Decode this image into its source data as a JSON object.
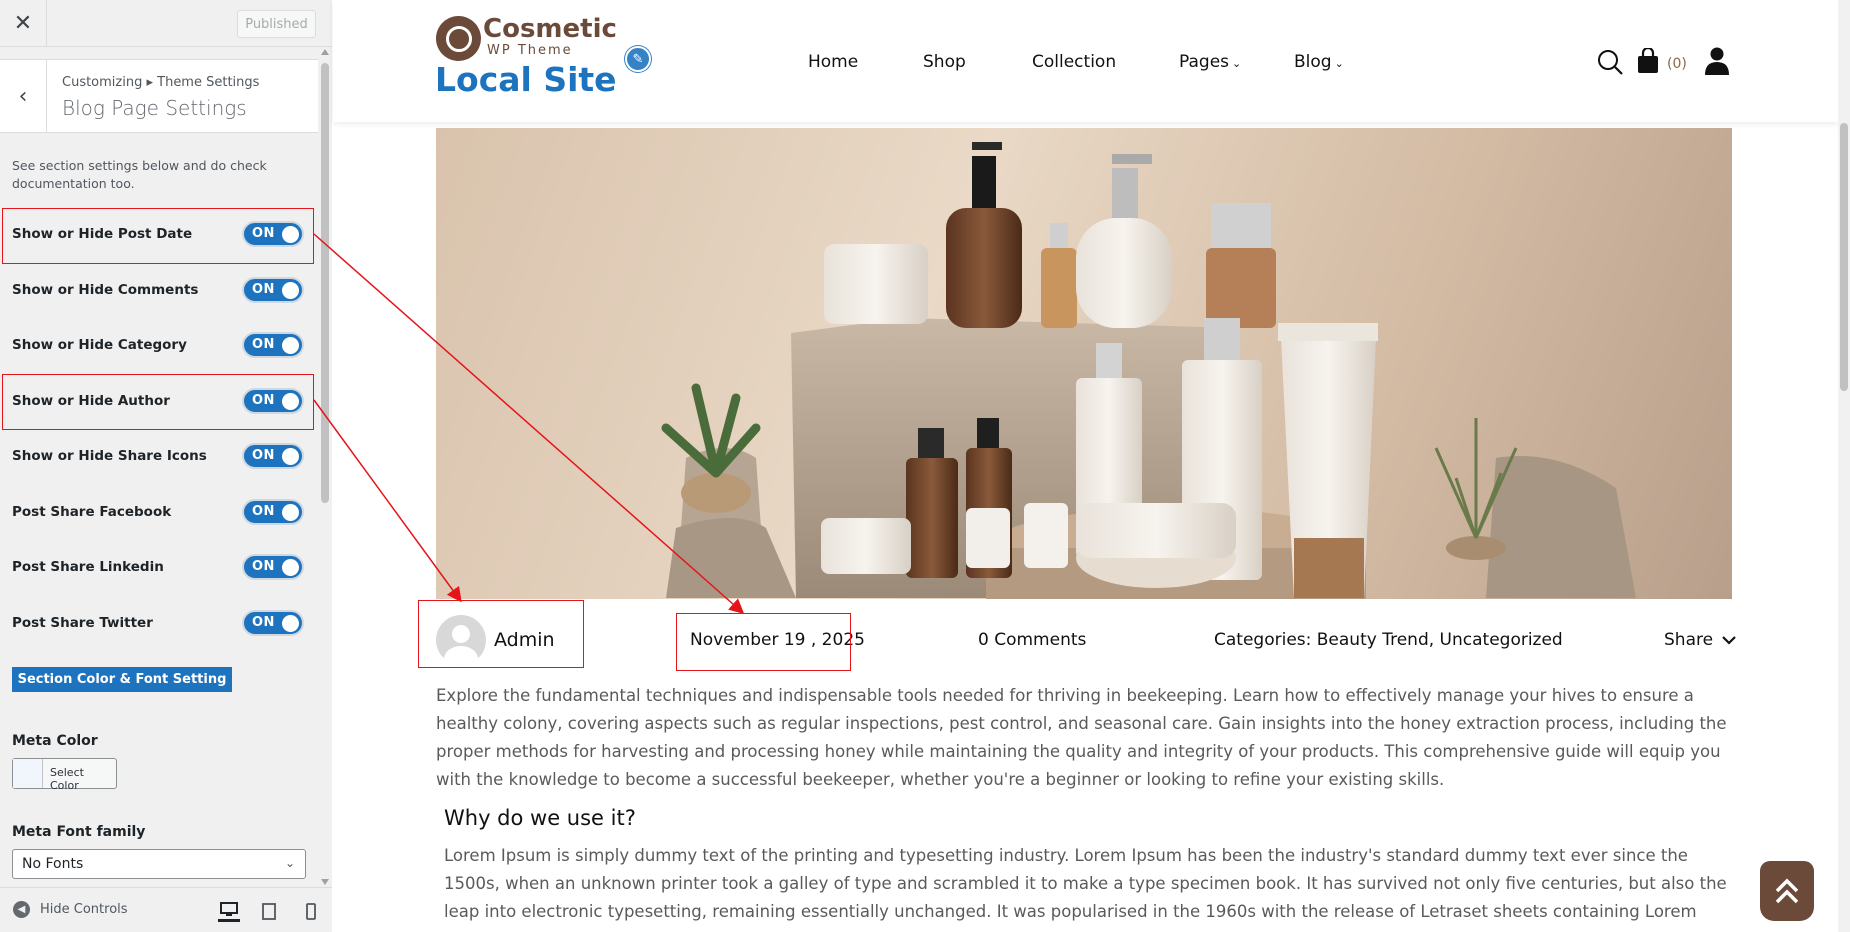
{
  "customizer": {
    "close_label": "✕",
    "published_label": "Published",
    "breadcrumb": "Customizing ▸ Theme Settings",
    "section_title": "Blog Page Settings",
    "description": "See section settings below and do check documentation too.",
    "toggles": [
      {
        "label": "Show or Hide Post Date",
        "state": "ON"
      },
      {
        "label": "Show or Hide Comments",
        "state": "ON"
      },
      {
        "label": "Show or Hide Category",
        "state": "ON"
      },
      {
        "label": "Show or Hide Author",
        "state": "ON"
      },
      {
        "label": "Show or Hide Share Icons",
        "state": "ON"
      },
      {
        "label": "Post Share Facebook",
        "state": "ON"
      },
      {
        "label": "Post Share Linkedin",
        "state": "ON"
      },
      {
        "label": "Post Share Twitter",
        "state": "ON"
      }
    ],
    "font_setting_button": "Section Color & Font Setting",
    "meta_color_label": "Meta Color",
    "select_color_label": "Select Color",
    "meta_font_label": "Meta Font family",
    "meta_font_value": "No Fonts",
    "hide_controls_label": "Hide Controls",
    "colors": {
      "accent": "#1e73be",
      "panel_bg": "#f0f0f1"
    }
  },
  "site": {
    "logo_name": "Cosmetic",
    "logo_sub": "WP Theme",
    "site_title": "Local Site",
    "nav": [
      "Home",
      "Shop",
      "Collection",
      "Pages",
      "Blog"
    ],
    "cart_count": "(0)",
    "colors": {
      "brand": "#6b4a3a",
      "title": "#1e73be",
      "highlight": "#e5141b"
    }
  },
  "post": {
    "author": "Admin",
    "date": "November 19 , 2025",
    "comments": "0 Comments",
    "categories": "Categories: Beauty Trend, Uncategorized",
    "share_label": "Share",
    "intro": "Explore the fundamental techniques and indispensable tools needed for thriving in beekeeping. Learn how to effectively manage your hives to ensure a healthy colony, covering aspects such as regular inspections, pest control, and seasonal care. Gain insights into the honey extraction process, including the proper methods for harvesting and processing honey while maintaining the quality and integrity of your products. This comprehensive guide will equip you with the knowledge to become a successful beekeeper, whether you're a beginner or looking to refine your existing skills.",
    "why_heading": "Why do we use it?",
    "lorem": "Lorem Ipsum is simply dummy text of the printing and typesetting industry. Lorem Ipsum has been the industry's standard dummy text ever since the 1500s, when an unknown printer took a galley of type and scrambled it to make a type specimen book. It has survived not only five centuries, but also the leap into electronic typesetting, remaining essentially unchanged. It was popularised in the 1960s with the release of Letraset sheets containing Lorem Ipsum passages, and more recently with desktop"
  }
}
